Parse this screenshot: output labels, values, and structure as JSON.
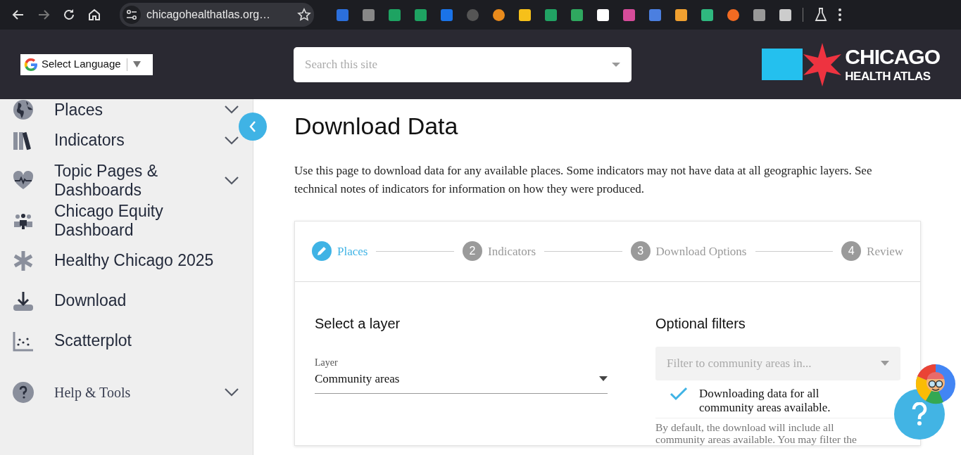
{
  "browser": {
    "url": "chicagohealthatlas.org…"
  },
  "header": {
    "language": "Select Language",
    "search_placeholder": "Search this site",
    "logo": {
      "line1": "CHICAGO",
      "line2": "HEALTH ATLAS"
    }
  },
  "sidebar": {
    "items": [
      {
        "label": "Places",
        "kind": "globe",
        "expandable": true
      },
      {
        "label": "Indicators",
        "kind": "books",
        "expandable": true
      },
      {
        "label": "Topic Pages & Dashboards",
        "kind": "heart",
        "expandable": true
      },
      {
        "label": "Chicago Equity Dashboard",
        "kind": "people",
        "expandable": false
      },
      {
        "label": "Healthy Chicago 2025",
        "kind": "asterisk",
        "expandable": false
      },
      {
        "label": "Download",
        "kind": "download",
        "expandable": false
      },
      {
        "label": "Scatterplot",
        "kind": "scatter",
        "expandable": false
      }
    ],
    "footer_item": {
      "label": "Help & Tools",
      "expandable": true
    }
  },
  "main": {
    "title": "Download Data",
    "intro": "Use this page to download data for any available places. Some indicators may not have data at all geographic layers. See technical notes of indicators for information on how they were produced.",
    "steps": [
      {
        "kind": "edit",
        "label": "Places",
        "selected": true
      },
      {
        "kind": "number",
        "number": "2",
        "label": "Indicators",
        "selected": false
      },
      {
        "kind": "number",
        "number": "3",
        "label": "Download Options",
        "selected": false
      },
      {
        "kind": "number",
        "number": "4",
        "label": "Review",
        "selected": false
      }
    ],
    "layer": {
      "heading": "Select a layer",
      "field_label": "Layer",
      "value": "Community areas"
    },
    "filters": {
      "heading": "Optional filters",
      "placeholder": "Filter to community areas in...",
      "notice": "Downloading data for all community areas available.",
      "help_text": "By default, the download will include all community areas available. You may filter the"
    }
  }
}
